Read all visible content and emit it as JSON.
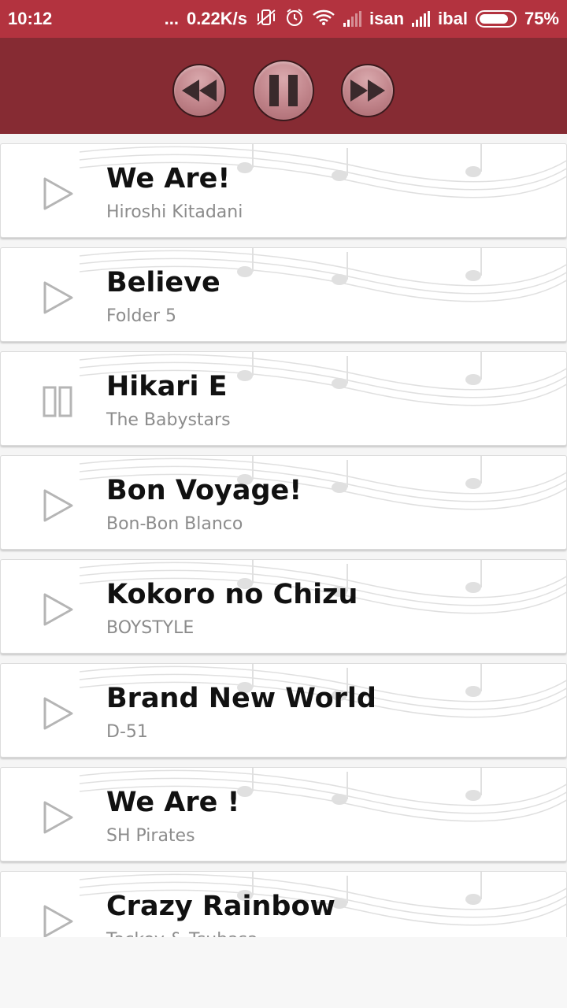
{
  "status_bar": {
    "time": "10:12",
    "dots": "...",
    "speed": "0.22K/s",
    "carrier1": "isan",
    "carrier2": "ibal",
    "battery": "75%"
  },
  "player": {
    "buttons": [
      "previous-icon",
      "pause-icon",
      "next-icon"
    ],
    "colors": {
      "header": "#862b33",
      "status": "#b3333f"
    }
  },
  "songs": [
    {
      "title": "We Are!",
      "artist": "Hiroshi Kitadani",
      "state": "play"
    },
    {
      "title": "Believe",
      "artist": "Folder 5",
      "state": "play"
    },
    {
      "title": "Hikari E",
      "artist": "The Babystars",
      "state": "pause"
    },
    {
      "title": "Bon Voyage!",
      "artist": "Bon-Bon Blanco",
      "state": "play"
    },
    {
      "title": "Kokoro no Chizu",
      "artist": "BOYSTYLE",
      "state": "play"
    },
    {
      "title": "Brand New World",
      "artist": "D-51",
      "state": "play"
    },
    {
      "title": "We Are !",
      "artist": "SH Pirates",
      "state": "play"
    },
    {
      "title": "Crazy Rainbow",
      "artist": "Tackey & Tsubasa",
      "state": "play"
    }
  ]
}
